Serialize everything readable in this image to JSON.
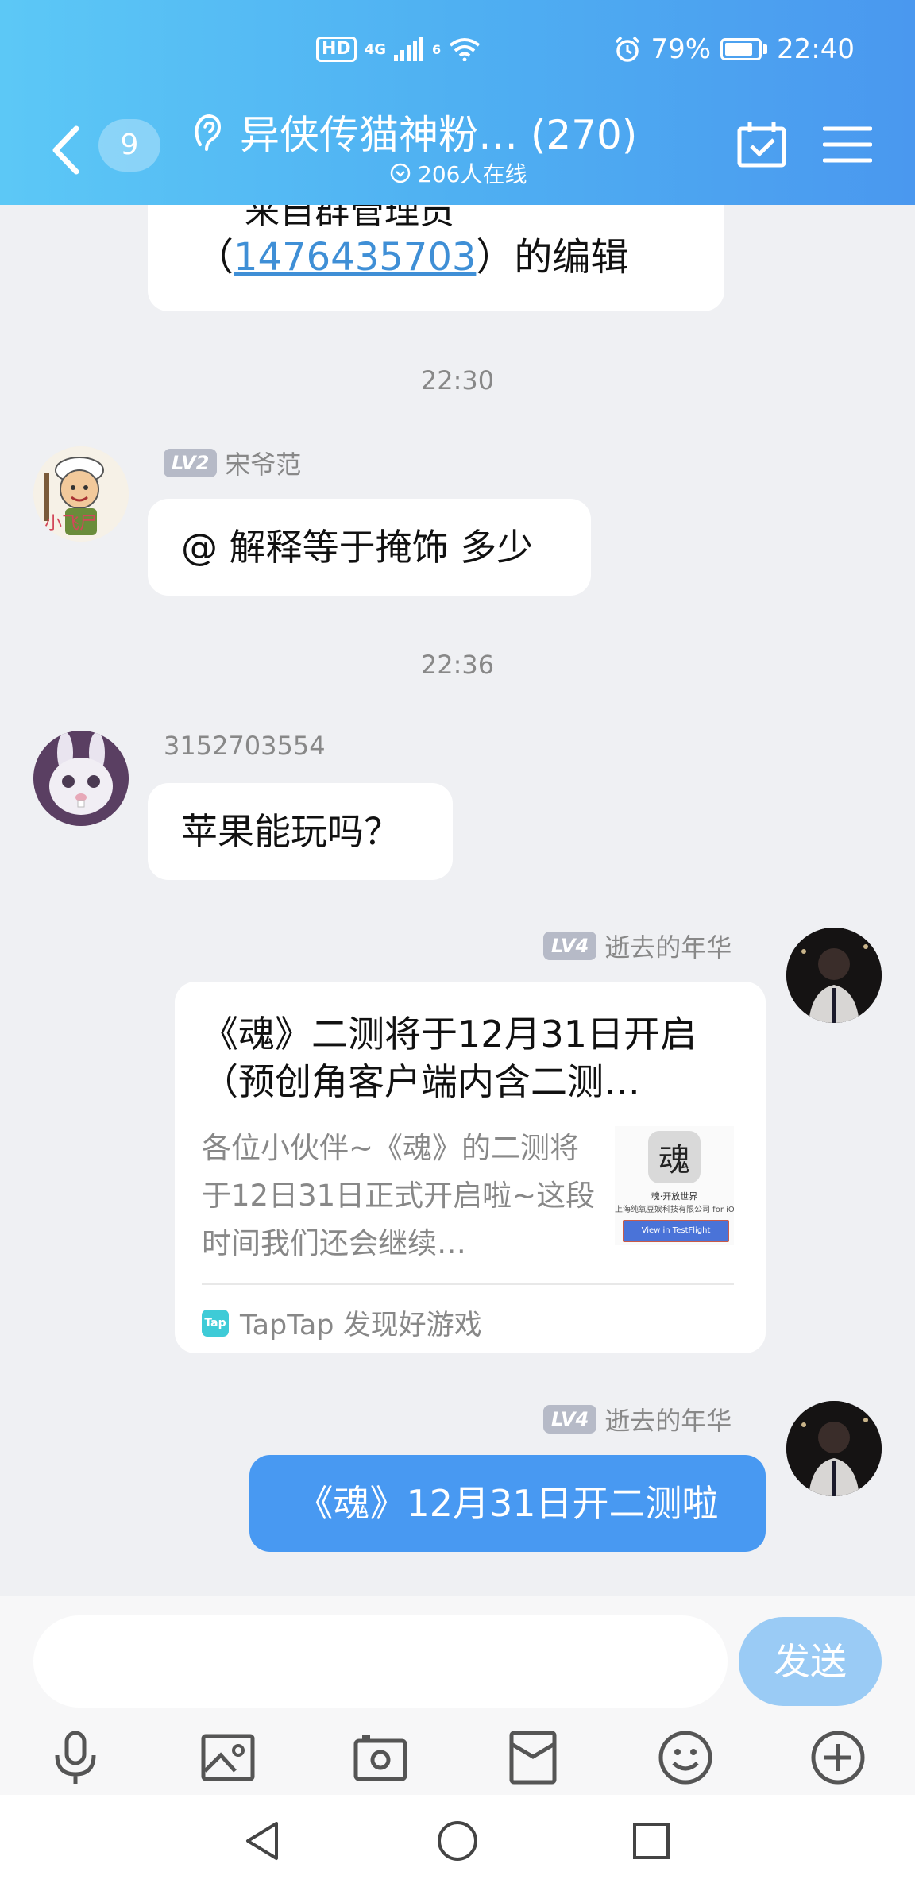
{
  "status_bar": {
    "network": "4G",
    "hd": "HD",
    "signal_extra": "6",
    "battery": "79%",
    "time": "22:40"
  },
  "header": {
    "unread_count": "9",
    "title": "异侠传猫神粉…  (270)",
    "online": "206人在线"
  },
  "messages": {
    "partial_top": {
      "line1": "来自群管理员",
      "link": "1476435703",
      "line2_prefix": "（",
      "line2_suffix": "）的编辑"
    },
    "time1": "22:30",
    "msg1": {
      "level": "LV2",
      "name": "宋爷范",
      "text": "@ 解释等于掩饰 多少"
    },
    "time2": "22:36",
    "msg2": {
      "name": "3152703554",
      "text": "苹果能玩吗？"
    },
    "msg3": {
      "level": "LV4",
      "name": "逝去的年华",
      "card_title": "《魂》二测将于12月31日开启（预创角客户端内含二测…",
      "card_desc": "各位小伙伴~《魂》的二测将于12日31日正式开启啦~这段时间我们还会继续…",
      "thumb_caption": "魂·开放世界",
      "thumb_company": "上海纯氧豆娱科技有限公司 for iOS",
      "thumb_button": "View in TestFlight",
      "source_logo": "Tap",
      "source": "TapTap 发现好游戏"
    },
    "msg4": {
      "level": "LV4",
      "name": "逝去的年华",
      "text": "《魂》12月31日开二测啦"
    }
  },
  "input": {
    "placeholder": "",
    "send": "发送"
  },
  "toolbar": [
    "mic-icon",
    "image-icon",
    "camera-icon",
    "red-packet-icon",
    "emoji-icon",
    "plus-icon"
  ],
  "colors": {
    "header_start": "#5cc8f6",
    "header_end": "#4a98ef",
    "my_bubble": "#4899f2",
    "send_button": "#9acbf5",
    "link": "#3f8fd6"
  }
}
